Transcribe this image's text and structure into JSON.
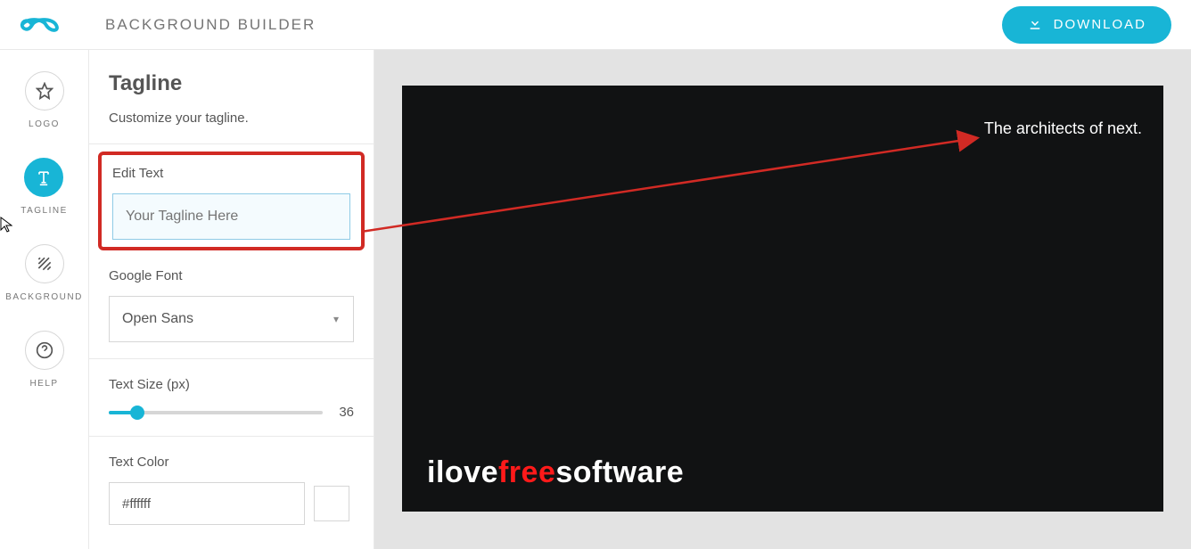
{
  "header": {
    "app_title": "BACKGROUND BUILDER",
    "download_label": "DOWNLOAD"
  },
  "rail": {
    "items": [
      {
        "label": "LOGO",
        "icon": "star-icon"
      },
      {
        "label": "TAGLINE",
        "icon": "text-icon",
        "active": true
      },
      {
        "label": "BACKGROUND",
        "icon": "texture-icon"
      },
      {
        "label": "HELP",
        "icon": "question-icon"
      }
    ]
  },
  "panel": {
    "title": "Tagline",
    "subtitle": "Customize your tagline.",
    "edit_text_label": "Edit Text",
    "tagline_placeholder": "Your Tagline Here",
    "font_label": "Google Font",
    "font_value": "Open Sans",
    "size_label": "Text Size (px)",
    "size_value": "36",
    "color_label": "Text Color",
    "color_value": "#ffffff"
  },
  "canvas": {
    "tagline_text": "The architects of next.",
    "watermark_a": "ilove",
    "watermark_b": "free",
    "watermark_c": "software"
  }
}
